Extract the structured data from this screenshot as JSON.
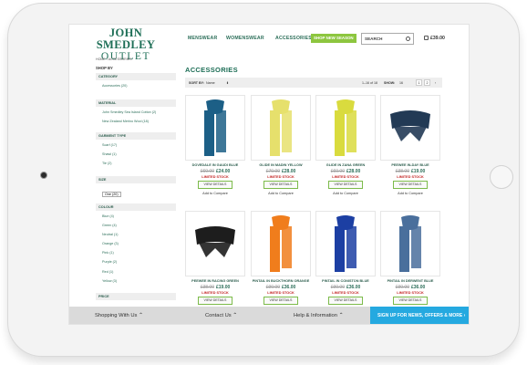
{
  "header": {
    "logo_line1": "JOHN SMEDLEY",
    "logo_line2": "OUTLET",
    "nav": [
      "MENSWEAR",
      "WOMENSWEAR",
      "ACCESSORIES"
    ],
    "promo": "SHOP NEW SEASON",
    "search_placeholder": "SEARCH",
    "cart_total": "£39.00"
  },
  "breadcrumb": "HOME  /  ACCESSORIES",
  "sidebar": {
    "shop_by": "SHOP BY",
    "category": {
      "title": "CATEGORY",
      "items": [
        "Accessories (20)"
      ]
    },
    "material": {
      "title": "MATERIAL",
      "items": [
        "John Smedley Sea Island Cotton (2)",
        "New Zealand Merino Wool (18)"
      ]
    },
    "garment_type": {
      "title": "GARMENT TYPE",
      "items": [
        "Scarf (17)",
        "Shawl (1)",
        "Tie (2)"
      ]
    },
    "size": {
      "title": "SIZE",
      "items": [
        "One (20)"
      ]
    },
    "colour": {
      "title": "COLOUR",
      "items": [
        "Blue (4)",
        "Green (4)",
        "Neutral (1)",
        "Orange (3)",
        "Pink (1)",
        "Purple (2)",
        "Red (1)",
        "Yellow (3)"
      ]
    },
    "price": {
      "title": "PRICE"
    }
  },
  "main": {
    "title": "ACCESSORIES",
    "sort_label": "SORT BY:",
    "sort_value": "Name",
    "count": "1–16 of 18",
    "show_label": "SHOW:",
    "show_value": "16",
    "pages": [
      "1",
      "2",
      "›"
    ]
  },
  "products": [
    {
      "name": "DOVEDALE IN GAUDI BLUE",
      "was": "£60.00",
      "now": "£24.00",
      "stock": "LIMITED STOCK",
      "button": "VIEW DETAILS",
      "compare": "Add to Compare",
      "color": "#1c5f86",
      "icon": "scarf"
    },
    {
      "name": "GLIDE IN MADIN YELLOW",
      "was": "£70.00",
      "now": "£28.00",
      "stock": "LIMITED STOCK",
      "button": "VIEW DETAILS",
      "compare": "Add to Compare",
      "color": "#e6e06c",
      "icon": "scarf"
    },
    {
      "name": "GLIDE IN ZANA GREEN",
      "was": "£60.00",
      "now": "£28.00",
      "stock": "LIMITED STOCK",
      "button": "VIEW DETAILS",
      "compare": "Add to Compare",
      "color": "#d9db3e",
      "icon": "scarf"
    },
    {
      "name": "PEEWEE IN-DAY BLUE",
      "was": "£38.00",
      "now": "£19.00",
      "stock": "LIMITED STOCK",
      "button": "VIEW DETAILS",
      "compare": "Add to Compare",
      "color": "#223a55",
      "icon": "bowtie"
    },
    {
      "name": "PEEWEE IN RACING GREEN",
      "was": "£38.00",
      "now": "£19.00",
      "stock": "LIMITED STOCK",
      "button": "VIEW DETAILS",
      "compare": "Add to Compare",
      "color": "#1d1d1d",
      "icon": "bowtie"
    },
    {
      "name": "PINTAIL IN BUCKTHORN ORANGE",
      "was": "£90.00",
      "now": "£36.00",
      "stock": "LIMITED STOCK",
      "button": "VIEW DETAILS",
      "compare": "",
      "color": "#f07d1c",
      "icon": "scarf"
    },
    {
      "name": "PINTAIL IN CONISTON BLUE",
      "was": "£90.00",
      "now": "£36.00",
      "stock": "LIMITED STOCK",
      "button": "VIEW DETAILS",
      "compare": "",
      "color": "#1c3fa3",
      "icon": "scarf"
    },
    {
      "name": "PINTAIL IN DERWENT BLUE",
      "was": "£90.00",
      "now": "£36.00",
      "stock": "LIMITED STOCK",
      "button": "VIEW DETAILS",
      "compare": "",
      "color": "#4a6f9c",
      "icon": "scarf"
    }
  ],
  "footer": {
    "shopping": "Shopping With Us ⌃",
    "contact": "Contact Us ⌃",
    "help": "Help & Information ⌃",
    "signup": "SIGN UP FOR NEWS, OFFERS & MORE  ›"
  }
}
